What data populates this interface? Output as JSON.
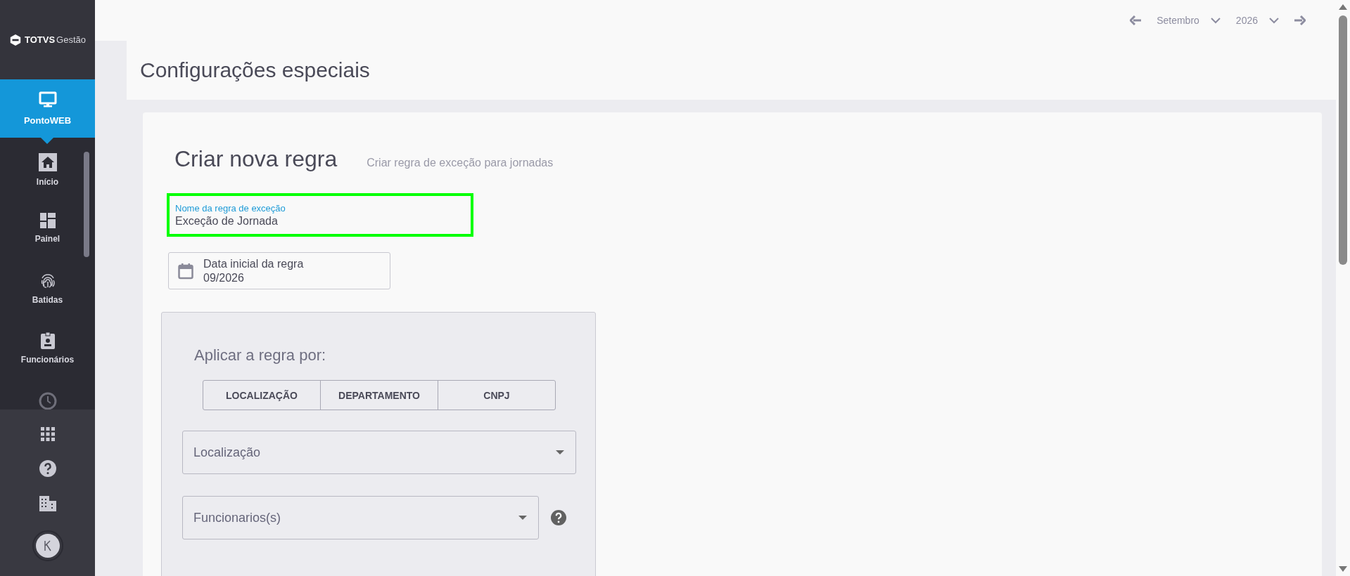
{
  "sidebar": {
    "logo": {
      "brand": "TOTVS",
      "product": "Gestão"
    },
    "module": {
      "label": "PontoWEB"
    },
    "items": [
      {
        "kind": "home",
        "label": "Início"
      },
      {
        "kind": "panel",
        "label": "Painel"
      },
      {
        "kind": "fingerprint",
        "label": "Batidas"
      },
      {
        "kind": "badge",
        "label": "Funcionários"
      }
    ]
  },
  "period": {
    "month": "Setembro",
    "year": "2026"
  },
  "page_title": "Configurações especiais",
  "form": {
    "title": "Criar nova regra",
    "subtitle": "Criar regra de exceção para jornadas",
    "name_field": {
      "label": "Nome da regra de exceção",
      "value": "Exceção de Jornada"
    },
    "date_field": {
      "label": "Data inicial da regra",
      "value": "09/2026"
    },
    "apply_by": {
      "label": "Aplicar a regra por:",
      "options": [
        "LOCALIZAÇÃO",
        "DEPARTAMENTO",
        "CNPJ"
      ]
    },
    "location_select": {
      "placeholder": "Localização"
    },
    "employees_select": {
      "placeholder": "Funcionarios(s)"
    }
  }
}
